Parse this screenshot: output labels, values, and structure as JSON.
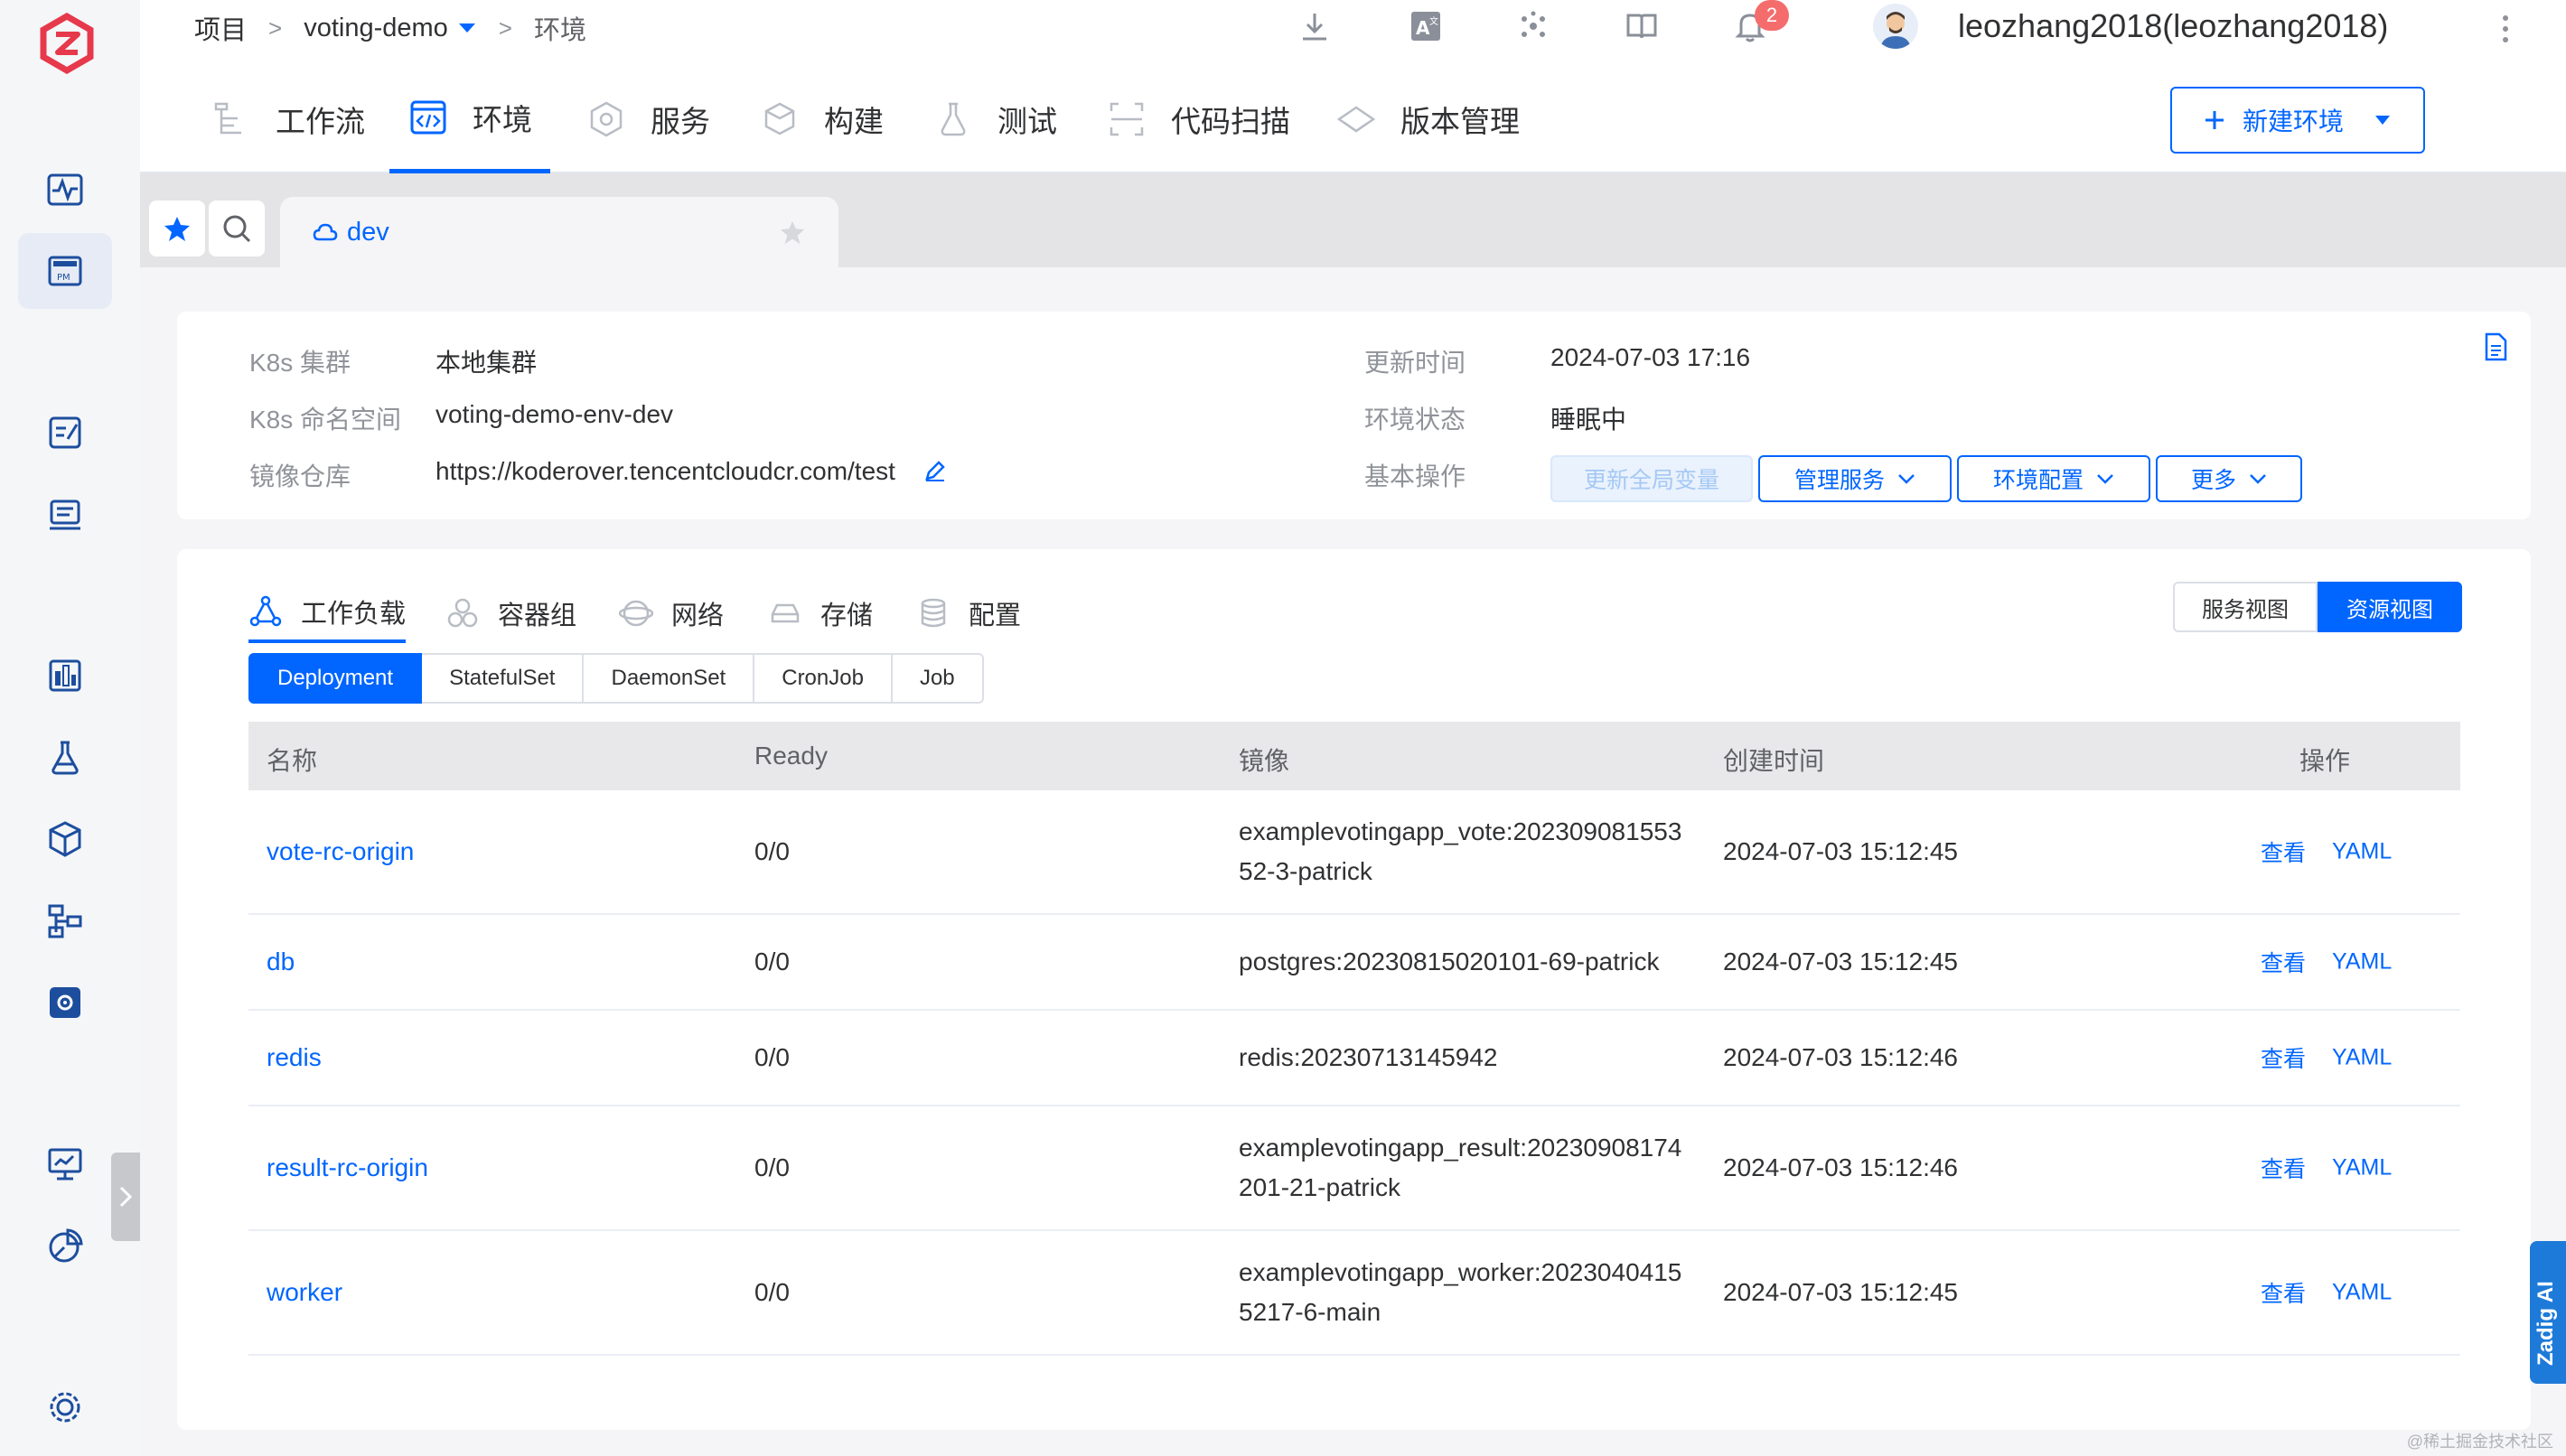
{
  "breadcrumb": {
    "root": "项目",
    "project": "voting-demo",
    "current": "环境"
  },
  "topbar": {
    "notifications": "2",
    "username": "leozhang2018(leozhang2018)"
  },
  "module_tabs": [
    {
      "label": "工作流",
      "icon": "workflow-icon"
    },
    {
      "label": "环境",
      "icon": "environment-icon"
    },
    {
      "label": "服务",
      "icon": "service-icon"
    },
    {
      "label": "构建",
      "icon": "build-icon"
    },
    {
      "label": "测试",
      "icon": "test-icon"
    },
    {
      "label": "代码扫描",
      "icon": "scan-icon"
    },
    {
      "label": "版本管理",
      "icon": "version-icon"
    }
  ],
  "new_env_label": "新建环境",
  "env_tab": {
    "name": "dev"
  },
  "info": {
    "cluster_label": "K8s 集群",
    "cluster_value": "本地集群",
    "namespace_label": "K8s 命名空间",
    "namespace_value": "voting-demo-env-dev",
    "registry_label": "镜像仓库",
    "registry_value": "https://koderover.tencentcloudcr.com/test",
    "updated_label": "更新时间",
    "updated_value": "2024-07-03 17:16",
    "status_label": "环境状态",
    "status_value": "睡眠中",
    "ops_label": "基本操作",
    "ops": {
      "update_vars": "更新全局变量",
      "manage_services": "管理服务",
      "env_config": "环境配置",
      "more": "更多"
    }
  },
  "sub_tabs": [
    "工作负载",
    "容器组",
    "网络",
    "存储",
    "配置"
  ],
  "view_switch": {
    "service_view": "服务视图",
    "resource_view": "资源视图"
  },
  "kind_tabs": [
    "Deployment",
    "StatefulSet",
    "DaemonSet",
    "CronJob",
    "Job"
  ],
  "table": {
    "headers": {
      "name": "名称",
      "ready": "Ready",
      "image": "镜像",
      "created": "创建时间",
      "actions": "操作"
    },
    "rows": [
      {
        "name": "vote-rc-origin",
        "ready": "0/0",
        "image": "examplevotingapp_vote:20230908155352-3-patrick",
        "created": "2024-07-03 15:12:45",
        "view": "查看",
        "yaml": "YAML"
      },
      {
        "name": "db",
        "ready": "0/0",
        "image": "postgres:20230815020101-69-patrick",
        "created": "2024-07-03 15:12:45",
        "view": "查看",
        "yaml": "YAML"
      },
      {
        "name": "redis",
        "ready": "0/0",
        "image": "redis:20230713145942",
        "created": "2024-07-03 15:12:46",
        "view": "查看",
        "yaml": "YAML"
      },
      {
        "name": "result-rc-origin",
        "ready": "0/0",
        "image": "examplevotingapp_result:20230908174201-21-patrick",
        "created": "2024-07-03 15:12:46",
        "view": "查看",
        "yaml": "YAML"
      },
      {
        "name": "worker",
        "ready": "0/0",
        "image": "examplevotingapp_worker:20230404155217-6-main",
        "created": "2024-07-03 15:12:45",
        "view": "查看",
        "yaml": "YAML"
      }
    ]
  },
  "zadig_ai": "Zadig AI",
  "watermark": "@稀土掘金技术社区",
  "colors": {
    "accent": "#0066ff",
    "badge": "#f56c6c",
    "logo": "#e6394b"
  }
}
